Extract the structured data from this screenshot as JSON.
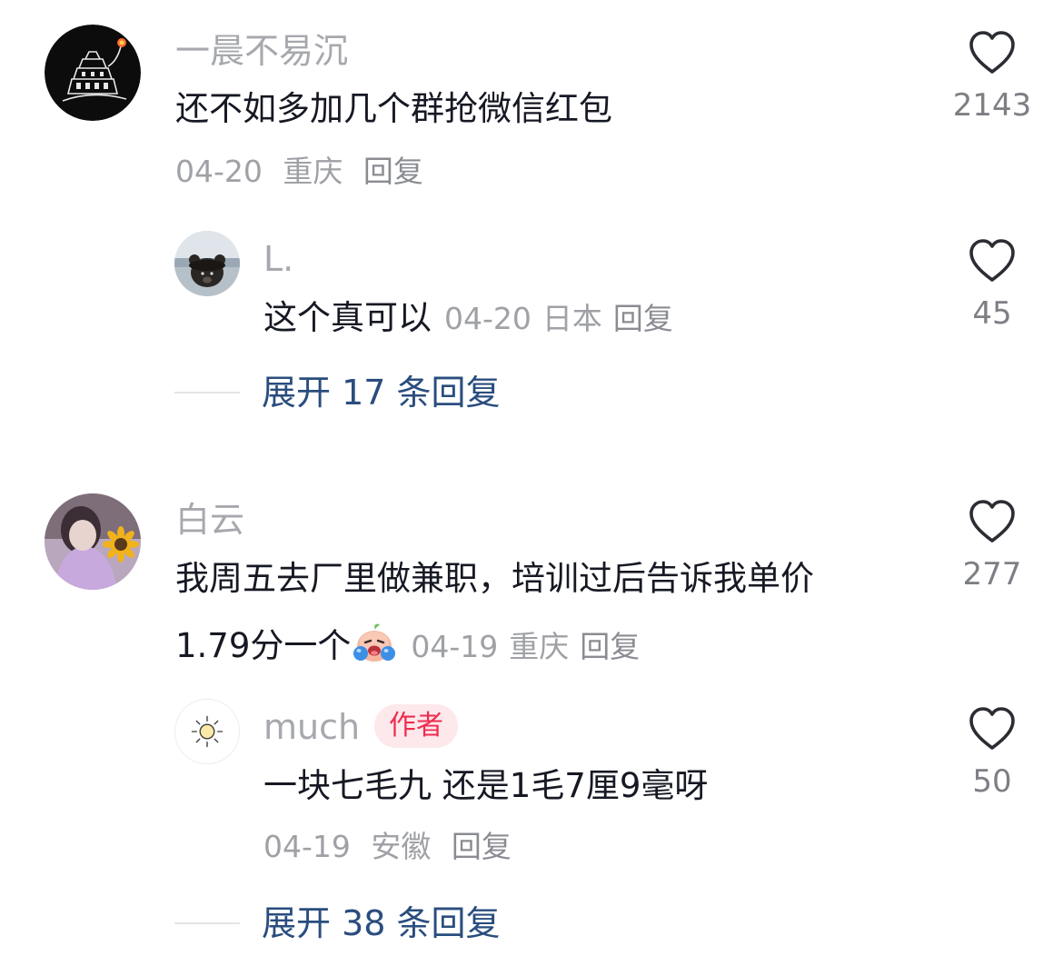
{
  "comments": [
    {
      "username": "一晨不易沉",
      "text": "还不如多加几个群抢微信红包",
      "date": "04-20",
      "location": "重庆",
      "reply_label": "回复",
      "likes": "2143",
      "avatar_icon": "dark-tower-torch-avatar",
      "replies": [
        {
          "username": "L.",
          "text": "这个真可以",
          "date": "04-20",
          "location": "日本",
          "reply_label": "回复",
          "likes": "45",
          "avatar_icon": "bear-sea-avatar"
        }
      ],
      "expand_label": "展开 17 条回复"
    },
    {
      "username": "白云",
      "text_line1": "我周五去厂里做兼职，培训过后告诉我单价",
      "text_line2": "1.79分一个",
      "emoji": "crying-face-emoji",
      "date": "04-19",
      "location": "重庆",
      "reply_label": "回复",
      "likes": "277",
      "avatar_icon": "purple-girl-sunflower-avatar",
      "replies": [
        {
          "username": "much",
          "badge": "作者",
          "text": "一块七毛九 还是1毛7厘9毫呀",
          "date": "04-19",
          "location": "安徽",
          "reply_label": "回复",
          "likes": "50",
          "avatar_icon": "sun-avatar"
        }
      ],
      "expand_label": "展开 38 条回复"
    }
  ],
  "colors": {
    "username": "#a6a8ad",
    "content": "#161823",
    "meta": "#9fa1a6",
    "expand_link": "#2a4d7e",
    "author_badge_bg": "#fde8ec",
    "author_badge_text": "#ee2d50"
  }
}
